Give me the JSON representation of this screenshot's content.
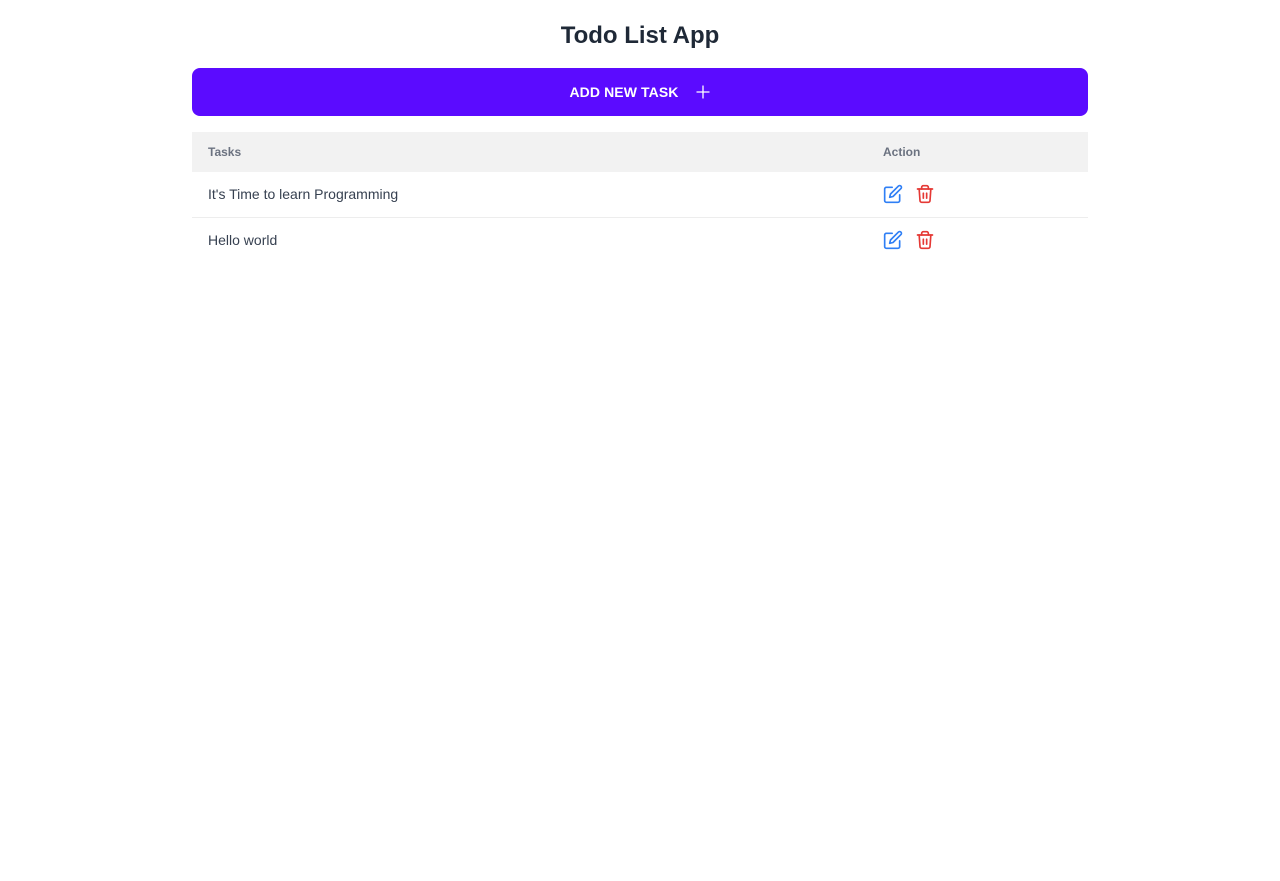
{
  "app": {
    "title": "Todo List App"
  },
  "toolbar": {
    "add_label": "ADD NEW TASK",
    "add_icon": "plus-icon"
  },
  "table": {
    "headers": {
      "tasks": "Tasks",
      "action": "Action"
    },
    "rows": [
      {
        "task": "It's Time to learn Programming",
        "edit_icon": "edit-icon",
        "delete_icon": "trash-icon"
      },
      {
        "task": "Hello world",
        "edit_icon": "edit-icon",
        "delete_icon": "trash-icon"
      }
    ]
  },
  "colors": {
    "accent": "#5b0bff",
    "edit": "#2f7ff5",
    "delete": "#e53935",
    "header_bg": "#f2f2f2"
  }
}
